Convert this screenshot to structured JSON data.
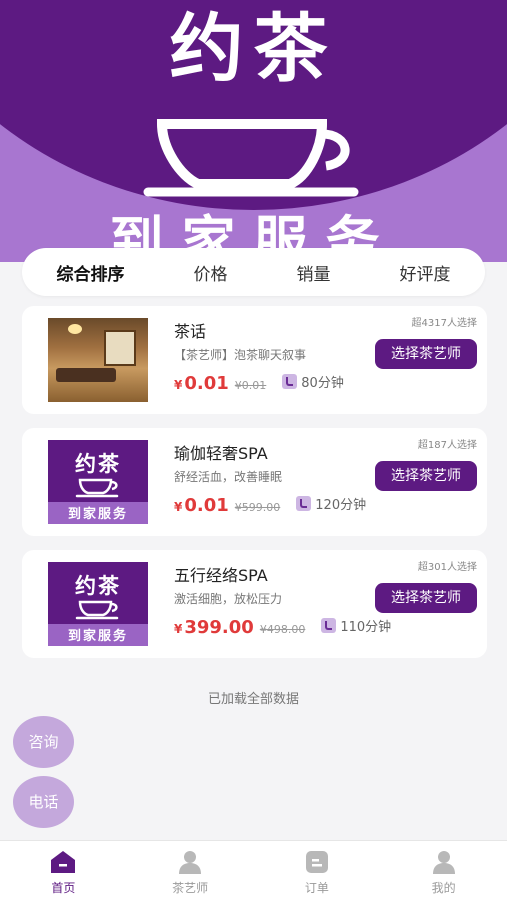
{
  "banner": {
    "title": "约茶",
    "subtitle": "到家服务",
    "icon": "teacup-icon"
  },
  "sort_tabs": [
    {
      "label": "综合排序",
      "active": true
    },
    {
      "label": "价格",
      "active": false
    },
    {
      "label": "销量",
      "active": false
    },
    {
      "label": "好评度",
      "active": false
    }
  ],
  "services": [
    {
      "name": "茶话",
      "desc": "【茶艺师】泡茶聊天叙事",
      "currency": "¥",
      "price": "0.01",
      "original_price": "¥0.01",
      "duration": "80分钟",
      "chosen": "超4317人选择",
      "button": "选择茶艺师",
      "thumb": "room-photo"
    },
    {
      "name": "瑜伽轻奢SPA",
      "desc": "舒经活血，改善睡眠",
      "currency": "¥",
      "price": "0.01",
      "original_price": "¥599.00",
      "duration": "120分钟",
      "chosen": "超187人选择",
      "button": "选择茶艺师",
      "thumb": "logo",
      "thumb_title": "约茶",
      "thumb_sub": "到家服务"
    },
    {
      "name": "五行经络SPA",
      "desc": "激活细胞，放松压力",
      "currency": "¥",
      "price": "399.00",
      "original_price": "¥498.00",
      "duration": "110分钟",
      "chosen": "超301人选择",
      "button": "选择茶艺师",
      "thumb": "logo",
      "thumb_title": "约茶",
      "thumb_sub": "到家服务"
    }
  ],
  "loaded_text": "已加载全部数据",
  "float_buttons": {
    "consult": "咨询",
    "phone": "电话"
  },
  "bottom_nav": [
    {
      "label": "首页",
      "icon": "home-icon",
      "active": true
    },
    {
      "label": "茶艺师",
      "icon": "user-icon",
      "active": false
    },
    {
      "label": "订单",
      "icon": "order-icon",
      "active": false
    },
    {
      "label": "我的",
      "icon": "profile-icon",
      "active": false
    }
  ],
  "colors": {
    "brand": "#5d1a82",
    "brand_light": "#a876d0",
    "price": "#e03a3a",
    "nav_inactive": "#9a9a9a"
  }
}
